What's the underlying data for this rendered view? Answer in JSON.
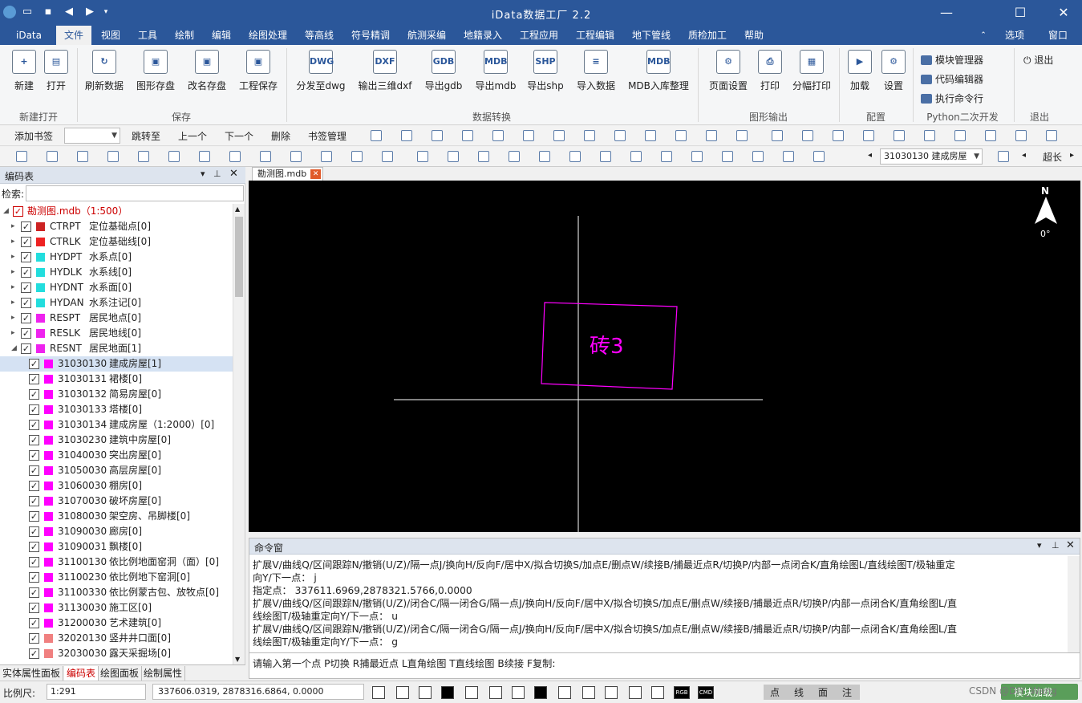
{
  "app": {
    "title": "iData数据工厂 2.2"
  },
  "menu": {
    "items": [
      "iData",
      "文件",
      "视图",
      "工具",
      "绘制",
      "编辑",
      "绘图处理",
      "等高线",
      "符号精调",
      "航测采编",
      "地籍录入",
      "工程应用",
      "工程编辑",
      "地下管线",
      "质检加工",
      "帮助"
    ],
    "right": [
      "选项",
      "窗口"
    ]
  },
  "ribbon": {
    "groups": [
      {
        "label": "新建打开"
      },
      {
        "label": "保存"
      },
      {
        "label": "数据转换"
      },
      {
        "label": "图形输出"
      },
      {
        "label": "配置"
      },
      {
        "label": "Python二次开发"
      },
      {
        "label": "退出"
      }
    ],
    "buttons": [
      "新建",
      "打开",
      "刷新数据",
      "图形存盘",
      "改名存盘",
      "工程保存",
      "分发至dwg",
      "输出三维dxf",
      "导出gdb",
      "导出mdb",
      "导出shp",
      "导入数据",
      "MDB入库整理",
      "页面设置",
      "打印",
      "分幅打印",
      "加载",
      "设置"
    ],
    "icon_texts": [
      "+",
      "▤",
      "↻",
      "▣",
      "▣",
      "▣",
      "DWG",
      "DXF",
      "GDB",
      "MDB",
      "SHP",
      "≡",
      "MDB",
      "⚙",
      "⎙",
      "▦",
      "▶",
      "⚙"
    ],
    "python_items": [
      "模块管理器",
      "代码编辑器",
      "执行命令行"
    ],
    "exit_label": "退出"
  },
  "bookmark": {
    "add": "添加书签",
    "jump": "跳转至",
    "prev": "上一个",
    "next": "下一个",
    "delete": "删除",
    "manage": "书签管理"
  },
  "toolbar2": {
    "layer_combo": "31030130 建成房屋",
    "overflow": "超长"
  },
  "left_panel": {
    "title": "编码表",
    "search_label": "检索:",
    "root": "勘测图.mdb（1:500）",
    "items": [
      {
        "code": "CTRPT",
        "name": "定位基础点[0]",
        "color": "#cc2222",
        "level": 1
      },
      {
        "code": "CTRLK",
        "name": "定位基础线[0]",
        "color": "#ee2222",
        "level": 1
      },
      {
        "code": "HYDPT",
        "name": "水系点[0]",
        "color": "#22dddd",
        "level": 1
      },
      {
        "code": "HYDLK",
        "name": "水系线[0]",
        "color": "#22dddd",
        "level": 1
      },
      {
        "code": "HYDNT",
        "name": "水系面[0]",
        "color": "#22dddd",
        "level": 1
      },
      {
        "code": "HYDAN",
        "name": "水系注记[0]",
        "color": "#22dddd",
        "level": 1
      },
      {
        "code": "RESPT",
        "name": "居民地点[0]",
        "color": "#ee22ee",
        "level": 1
      },
      {
        "code": "RESLK",
        "name": "居民地线[0]",
        "color": "#ee22ee",
        "level": 1
      },
      {
        "code": "RESNT",
        "name": "居民地面[1]",
        "color": "#ee22ee",
        "level": 1
      },
      {
        "code": "31030130",
        "name": "建成房屋[1]",
        "color": "#ff00ff",
        "level": 2,
        "selected": true
      },
      {
        "code": "31030131",
        "name": "裙楼[0]",
        "color": "#ff00ff",
        "level": 2
      },
      {
        "code": "31030132",
        "name": "简易房屋[0]",
        "color": "#ff00ff",
        "level": 2
      },
      {
        "code": "31030133",
        "name": "塔楼[0]",
        "color": "#ff00ff",
        "level": 2
      },
      {
        "code": "31030134",
        "name": "建成房屋（1:2000）[0]",
        "color": "#ff00ff",
        "level": 2
      },
      {
        "code": "31030230",
        "name": "建筑中房屋[0]",
        "color": "#ff00ff",
        "level": 2
      },
      {
        "code": "31040030",
        "name": "突出房屋[0]",
        "color": "#ff00ff",
        "level": 2
      },
      {
        "code": "31050030",
        "name": "高层房屋[0]",
        "color": "#ff00ff",
        "level": 2
      },
      {
        "code": "31060030",
        "name": "棚房[0]",
        "color": "#ff00ff",
        "level": 2
      },
      {
        "code": "31070030",
        "name": "破坏房屋[0]",
        "color": "#ff00ff",
        "level": 2
      },
      {
        "code": "31080030",
        "name": "架空房、吊脚楼[0]",
        "color": "#ff00ff",
        "level": 2
      },
      {
        "code": "31090030",
        "name": "廊房[0]",
        "color": "#ff00ff",
        "level": 2
      },
      {
        "code": "31090031",
        "name": "飘楼[0]",
        "color": "#ff00ff",
        "level": 2
      },
      {
        "code": "31100130",
        "name": "依比例地面窑洞（面）[0]",
        "color": "#ff00ff",
        "level": 2
      },
      {
        "code": "31100230",
        "name": "依比例地下窑洞[0]",
        "color": "#ff00ff",
        "level": 2
      },
      {
        "code": "31100330",
        "name": "依比例蒙古包、放牧点[0]",
        "color": "#ff00ff",
        "level": 2
      },
      {
        "code": "31130030",
        "name": "施工区[0]",
        "color": "#ff00ff",
        "level": 2
      },
      {
        "code": "31200030",
        "name": "艺术建筑[0]",
        "color": "#ff00ff",
        "level": 2
      },
      {
        "code": "32020130",
        "name": "竖井井口面[0]",
        "color": "#f08080",
        "level": 2
      },
      {
        "code": "32030030",
        "name": "露天采掘场[0]",
        "color": "#f08080",
        "level": 2
      }
    ],
    "tabs": [
      "实体属性面板",
      "编码表",
      "绘图面板",
      "绘制属性"
    ]
  },
  "document": {
    "tab": "勘测图.mdb",
    "label": "砖3",
    "north": "N",
    "angle": "0°"
  },
  "command": {
    "title": "命令窗",
    "lines": [
      "扩展V/曲线Q/区间跟踪N/撤销(U/Z)/隔一点J/换向H/反向F/居中X/拟合切换S/加点E/删点W/续接B/捕最近点R/切换P/内部一点闭合K/直角绘图L/直线绘图T/极轴重定",
      "向Y/下一点： j",
      "指定点： 337611.6969,2878321.5766,0.0000",
      "扩展V/曲线Q/区间跟踪N/撤销(U/Z)/闭合C/隔一闭合G/隔一点J/换向H/反向F/居中X/拟合切换S/加点E/删点W/续接B/捕最近点R/切换P/内部一点闭合K/直角绘图L/直",
      "线绘图T/极轴重定向Y/下一点： u",
      "扩展V/曲线Q/区间跟踪N/撤销(U/Z)/闭合C/隔一闭合G/隔一点J/换向H/反向F/居中X/拟合切换S/加点E/删点W/续接B/捕最近点R/切换P/内部一点闭合K/直角绘图L/直",
      "线绘图T/极轴重定向Y/下一点： g"
    ],
    "prompt": "请输入第一个点 P切换 R捕最近点 L直角绘图 T直线绘图 B续接 F复制:"
  },
  "status": {
    "scale_label": "比例尺:",
    "scale_value": "1:291",
    "coords": "337606.0319, 2878316.6864, 0.0000",
    "modes": [
      "点",
      "线",
      "面",
      "注"
    ],
    "icon_texts": [
      "RGB",
      "CMD"
    ],
    "watermark": "CSDN @DIY_Wang",
    "btn": "模块加载"
  }
}
